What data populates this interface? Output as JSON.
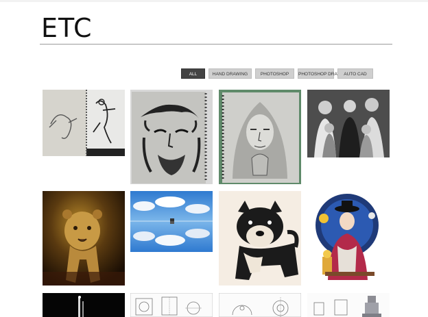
{
  "page": {
    "title": "ETC"
  },
  "filters": [
    {
      "label": "ALL",
      "active": true
    },
    {
      "label": "HAND DRAWING",
      "active": false
    },
    {
      "label": "PHOTOSHOP",
      "active": false
    },
    {
      "label": "PHOTOSHOP DRAWING",
      "active": false
    },
    {
      "label": "AUTO CAD",
      "active": false
    }
  ],
  "colors": {
    "active_filter": "#444444",
    "filter": "#cfcfcf",
    "rule": "#9a9a9a"
  },
  "gallery": [
    {
      "icon": "pencil-sketch-figures-image"
    },
    {
      "icon": "jesus-crown-of-thorns-sketch-image"
    },
    {
      "icon": "praying-mary-sketch-image"
    },
    {
      "icon": "vintage-family-photo-image"
    },
    {
      "icon": "lion-cub-painting-image"
    },
    {
      "icon": "salt-flat-sky-reflection-image"
    },
    {
      "icon": "shiba-dog-illustration-image"
    },
    {
      "icon": "korean-traditional-figure-illustration-image"
    },
    {
      "icon": "dark-night-scene-image"
    },
    {
      "icon": "cad-drawing-1-image"
    },
    {
      "icon": "cad-drawing-2-image"
    },
    {
      "icon": "cad-drawing-3-image"
    }
  ]
}
